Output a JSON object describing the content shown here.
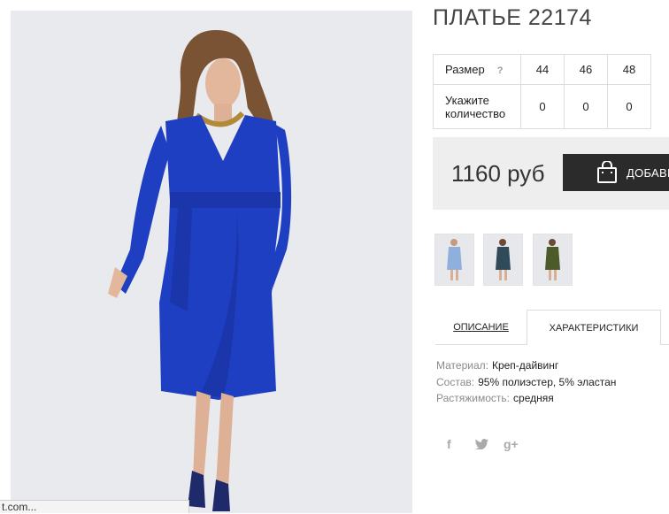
{
  "product": {
    "title": "ПЛАТЬЕ 22174",
    "price": "1160 руб",
    "add_to_cart": "ДОБАВИ"
  },
  "size_table": {
    "size_label": "Размер",
    "help_mark": "?",
    "qty_label_line1": "Укажите",
    "qty_label_line2": "количество",
    "sizes": [
      "44",
      "46",
      "48"
    ],
    "quantities": [
      "0",
      "0",
      "0"
    ]
  },
  "thumbnails": [
    {
      "name": "light-blue-dress"
    },
    {
      "name": "dark-teal-dress"
    },
    {
      "name": "olive-dress"
    }
  ],
  "tabs": {
    "description": "ОПИСАНИЕ",
    "characteristics": "ХАРАКТЕРИСТИКИ"
  },
  "specs": [
    {
      "key": "Материал:",
      "value": "Креп-дайвинг"
    },
    {
      "key": "Состав:",
      "value": "95% полиэстер, 5% эластан"
    },
    {
      "key": "Растяжимость:",
      "value": "средняя"
    }
  ],
  "social": {
    "facebook": "f",
    "gplus": "g+"
  },
  "status_bar": {
    "url": "t.com..."
  },
  "colors": {
    "dress": "#1f3fc2",
    "button": "#2b2b2b",
    "price_bg": "#eeeeee"
  }
}
